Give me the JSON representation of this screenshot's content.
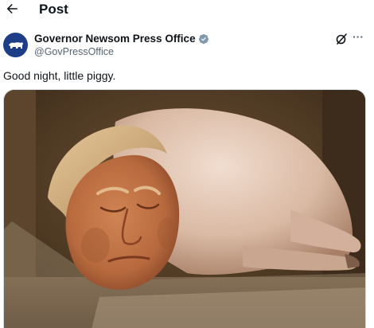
{
  "header": {
    "title": "Post",
    "back_icon": "arrow-left-icon"
  },
  "post": {
    "author_name": "Governor Newsom Press Office",
    "author_handle": "@GovPressOffice",
    "verified_icon": "verified-badge-icon",
    "avatar_icon": "state-bear-icon",
    "text": "Good night, little piggy.",
    "grok_icon": "grok-icon",
    "more_icon": "more-options-icon",
    "more_label": "···",
    "media_alt": "Image of a sleeping pig with a human head"
  },
  "colors": {
    "text_primary": "#0f1419",
    "text_secondary": "#536471",
    "verified": "#829aab",
    "avatar_bg": "#1d3d86"
  }
}
